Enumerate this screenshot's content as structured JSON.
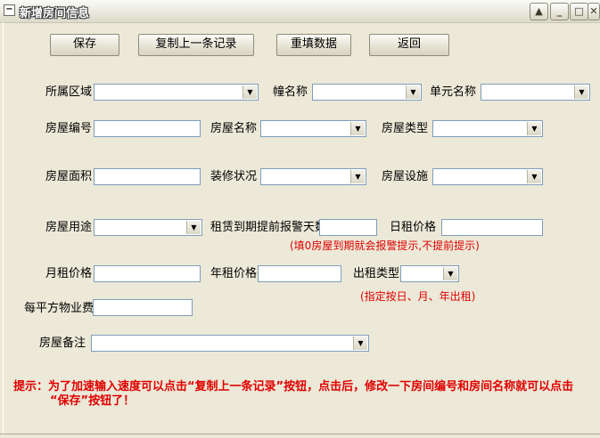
{
  "window": {
    "title": "新增房间信息",
    "system_icon": "minus-box-icon",
    "caption_buttons": {
      "restore": "◭",
      "minimize": "_",
      "maximize": "□",
      "close": "✕"
    }
  },
  "toolbar": {
    "save": "保存",
    "copy_last": "复制上一条记录",
    "refill": "重填数据",
    "back": "返回"
  },
  "form": {
    "area_label": "所属区域",
    "area_value": "",
    "building_label": "幢名称",
    "building_value": "",
    "unit_label": "单元名称",
    "unit_value": "",
    "room_no_label": "房屋编号",
    "room_no_value": "",
    "room_name_label": "房屋名称",
    "room_name_value": "",
    "room_type_label": "房屋类型",
    "room_type_value": "",
    "room_area_label": "房屋面积",
    "room_area_value": "",
    "decoration_label": "装修状况",
    "decoration_value": "",
    "facilities_label": "房屋设施",
    "facilities_value": "",
    "usage_label": "房屋用途",
    "usage_value": "",
    "warn_days_label": "租赁到期提前报警天数",
    "warn_days_value": "",
    "warn_days_hint": "(填0房屋到期就会报警提示,不提前提示)",
    "daily_rent_label": "日租价格",
    "daily_rent_value": "",
    "monthly_rent_label": "月租价格",
    "monthly_rent_value": "",
    "yearly_rent_label": "年租价格",
    "yearly_rent_value": "",
    "rent_type_label": "出租类型",
    "rent_type_value": "",
    "rent_type_hint": "(指定按日、月、年出租)",
    "property_fee_label": "每平方物业费",
    "property_fee_value": "",
    "remark_label": "房屋备注",
    "remark_value": ""
  },
  "tip": {
    "line1": "提示：为了加速输入速度可以点击“复制上一条记录”按钮，点击后，修改一下房间编号和房间名称就可以点击",
    "line2": "“保存”按钮了！"
  },
  "colors": {
    "hint": "#e00000",
    "background": "#ece9d8",
    "field_border": "#7f9db9"
  }
}
